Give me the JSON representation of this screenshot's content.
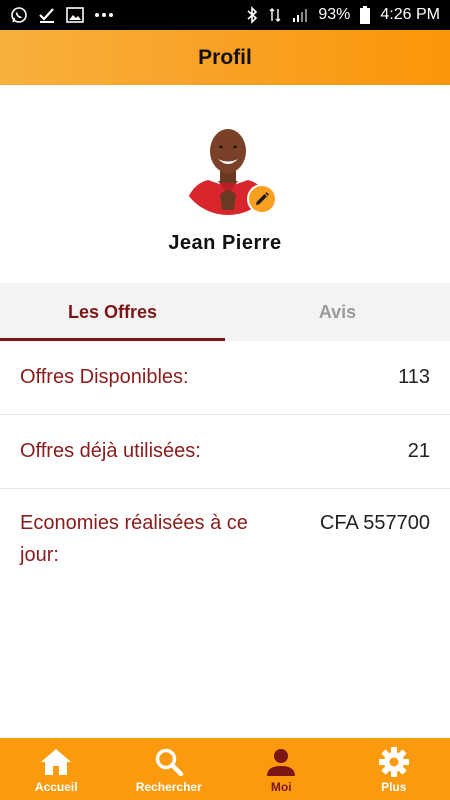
{
  "status_bar": {
    "battery": "93%",
    "time": "4:26 PM",
    "left_icons": [
      "whatsapp-icon",
      "check-icon",
      "image-icon",
      "more-icon"
    ],
    "right_icons": [
      "bluetooth-icon",
      "data-icon",
      "signal-icon",
      "battery-icon"
    ]
  },
  "app_bar": {
    "title": "Profil"
  },
  "profile": {
    "name": "Jean Pierre",
    "avatar": "avatar-photo",
    "edit_icon": "pencil-icon"
  },
  "tabs": [
    {
      "label": "Les Offres",
      "active": true
    },
    {
      "label": "Avis",
      "active": false
    }
  ],
  "stats": [
    {
      "label": "Offres Disponibles:",
      "value": "113"
    },
    {
      "label": "Offres déjà utilisées:",
      "value": "21"
    },
    {
      "label": "Economies réalisées à ce jour:",
      "value": "CFA 557700"
    }
  ],
  "bottom_nav": [
    {
      "label": "Accueil",
      "icon": "home-icon",
      "active": false
    },
    {
      "label": "Rechercher",
      "icon": "search-icon",
      "active": false
    },
    {
      "label": "Moi",
      "icon": "user-icon",
      "active": true
    },
    {
      "label": "Plus",
      "icon": "gear-icon",
      "active": false
    }
  ],
  "colors": {
    "accent_orange": "#fb9a0c",
    "maroon": "#7a1616",
    "label_red": "#8a1c1c"
  }
}
